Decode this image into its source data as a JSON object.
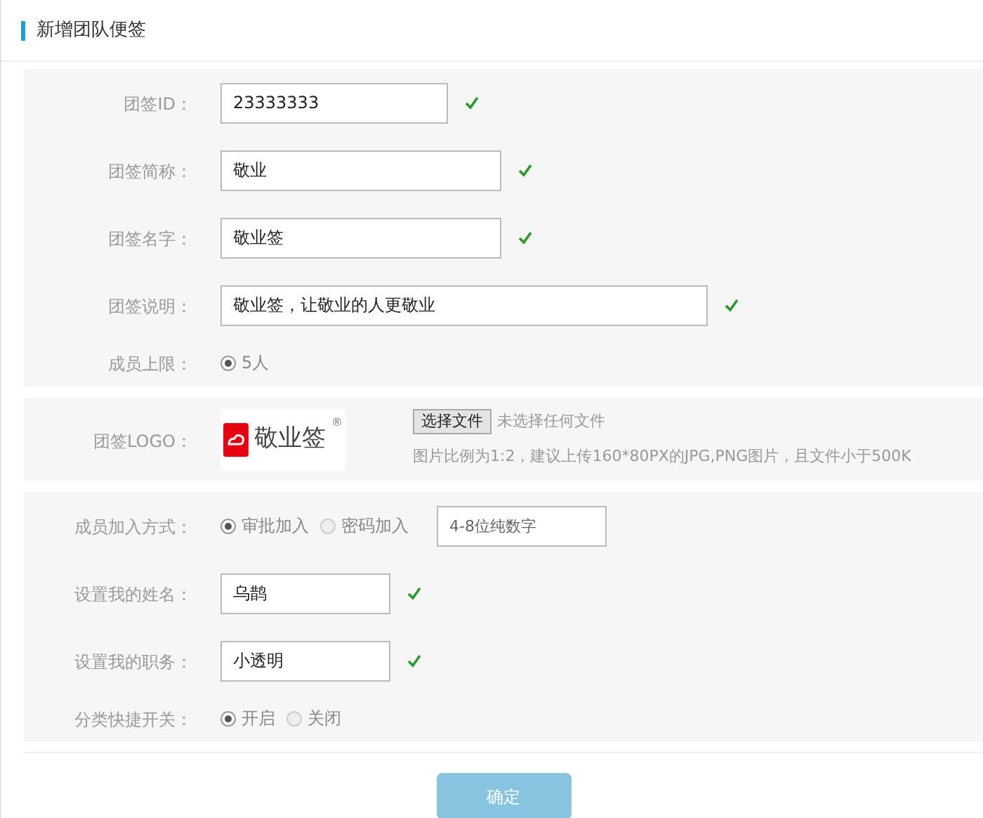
{
  "title": "新增团队便签",
  "sections": [
    {
      "rows": [
        {
          "kind": "input",
          "label": "团签ID：",
          "value": "23333333",
          "valid": true
        },
        {
          "kind": "input",
          "label": "团签简称：",
          "value": "敬业",
          "valid": true
        },
        {
          "kind": "input",
          "label": "团签名字：",
          "value": "敬业签",
          "valid": true
        },
        {
          "kind": "input",
          "label": "团签说明：",
          "value": "敬业签，让敬业的人更敬业",
          "valid": true
        },
        {
          "kind": "radio",
          "label": "成员上限：",
          "options": [
            {
              "label": "5人",
              "selected": true
            }
          ]
        }
      ]
    },
    {
      "rows": [
        {
          "kind": "logo",
          "label": "团签LOGO：",
          "logo_text": "敬业签",
          "logo_mark": "®",
          "file_button": "选择文件",
          "file_status": "未选择任何文件",
          "hint": "图片比例为1:2，建议上传160*80PX的JPG,PNG图片，且文件小于500K"
        }
      ]
    },
    {
      "rows": [
        {
          "kind": "join",
          "label": "成员加入方式：",
          "options": [
            {
              "label": "审批加入",
              "selected": true
            },
            {
              "label": "密码加入",
              "selected": false
            }
          ],
          "placeholder": "4-8位纯数字"
        },
        {
          "kind": "input",
          "label": "设置我的姓名：",
          "value": "乌鹊",
          "valid": true
        },
        {
          "kind": "input",
          "label": "设置我的职务：",
          "value": "小透明",
          "valid": true
        },
        {
          "kind": "radio",
          "label": "分类快捷开关：",
          "options": [
            {
              "label": "开启",
              "selected": true
            },
            {
              "label": "关闭",
              "selected": false
            }
          ]
        }
      ]
    }
  ],
  "submit": "确定"
}
